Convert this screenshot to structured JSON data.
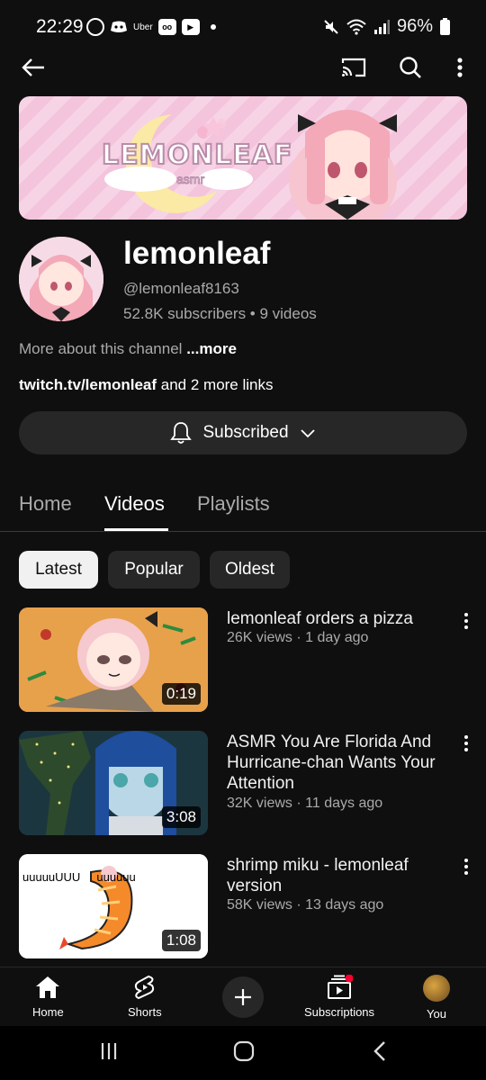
{
  "status_bar": {
    "time": "22:29",
    "app_label": "Uber",
    "battery": "96%"
  },
  "banner": {
    "logo_text": "LEMONLEAF",
    "logo_sub": "asmr"
  },
  "channel": {
    "name": "lemonleaf",
    "handle": "@lemonleaf8163",
    "stats": "52.8K subscribers • 9 videos",
    "about_text": "More about this channel",
    "about_more": "...more",
    "link_main": "twitch.tv/lemonleaf",
    "link_extra": "and 2 more links",
    "subscribe_label": "Subscribed"
  },
  "tabs": [
    {
      "label": "Home"
    },
    {
      "label": "Videos"
    },
    {
      "label": "Playlists"
    }
  ],
  "chips": [
    {
      "label": "Latest"
    },
    {
      "label": "Popular"
    },
    {
      "label": "Oldest"
    }
  ],
  "videos": [
    {
      "title": "lemonleaf orders a pizza",
      "meta": "26K views · 1 day ago",
      "duration": "0:19"
    },
    {
      "title": "ASMR You Are Florida And Hurricane-chan Wants Your Attention",
      "meta": "32K views · 11 days ago",
      "duration": "3:08"
    },
    {
      "title": "shrimp miku - lemonleaf version",
      "meta": "58K views · 13 days ago",
      "duration": "1:08",
      "thumb_text": "uuuuuUUU     uuuuuu"
    }
  ],
  "bottom_nav": [
    {
      "label": "Home",
      "icon": "home-icon"
    },
    {
      "label": "Shorts",
      "icon": "shorts-icon"
    },
    {
      "label": "Subscriptions",
      "icon": "subscriptions-icon"
    },
    {
      "label": "You",
      "icon": "avatar"
    }
  ],
  "colors": {
    "background": "#0f0f0f",
    "chip": "#272727",
    "notification": "#ff0033"
  }
}
